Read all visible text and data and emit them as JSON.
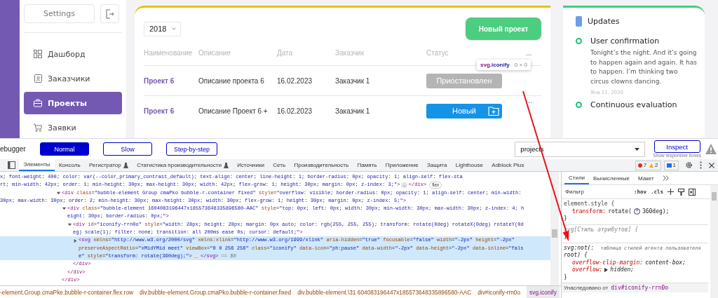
{
  "sidebar": {
    "settings": "Settings",
    "items": [
      {
        "label": "Дашборд",
        "selected": false
      },
      {
        "label": "Заказчики",
        "selected": false
      },
      {
        "label": "Проекты",
        "selected": true
      },
      {
        "label": "Заявки",
        "selected": false
      }
    ]
  },
  "projects": {
    "year": "2018",
    "new_button": "Новый проект",
    "columns": [
      "Наименование",
      "Описание",
      "Дата",
      "Заказчик",
      "Статус",
      "..."
    ],
    "rows": [
      {
        "name": "Проект 6",
        "description": "Описание проекта 6",
        "date": "16.02.2023",
        "customer": "Заказчик 1",
        "status": "Приостановлен",
        "kind": "paused",
        "tooltip": {
          "tag": "svg",
          "cls": ".iconify",
          "size": "0 × 0"
        }
      },
      {
        "name": "Проект 6",
        "description": "Описание Проект 6 +",
        "date": "16.02.2023",
        "customer": "Заказчик 1",
        "status": "Новый",
        "kind": "new",
        "menu": "..."
      }
    ]
  },
  "updates": {
    "title": "Updates",
    "items": [
      {
        "title": "User confirmation",
        "text": "Tonight’s the night. And it’s going to happen again and again. It has to happen. I’m thinking two circus clowns dancing.",
        "date": "Янв 21, 2020"
      },
      {
        "title": "Continuous evaluation"
      }
    ]
  },
  "debugger": {
    "label": "ebugger",
    "modes": [
      {
        "label": "Normal",
        "selected": true
      },
      {
        "label": "Slow",
        "selected": false
      },
      {
        "label": "Step-by-step",
        "selected": false
      }
    ],
    "page": "projects",
    "inspect": "Inspect",
    "inspect_hint": "Show responsive boxes"
  },
  "devtools": {
    "tabs": [
      {
        "label": "Элементы",
        "selected": true,
        "experimental": false
      },
      {
        "label": "Консоль",
        "selected": false,
        "experimental": false
      },
      {
        "label": "Регистратор",
        "selected": false,
        "experimental": true
      },
      {
        "label": "Статистика производительности",
        "selected": false,
        "experimental": true
      },
      {
        "label": "Источники",
        "selected": false,
        "experimental": false
      },
      {
        "label": "Сеть",
        "selected": false,
        "experimental": false
      },
      {
        "label": "Производительность",
        "selected": false,
        "experimental": false
      },
      {
        "label": "Память",
        "selected": false,
        "experimental": false
      },
      {
        "label": "Приложение",
        "selected": false,
        "experimental": false
      },
      {
        "label": "Защита",
        "selected": false,
        "experimental": false
      },
      {
        "label": "Lighthouse",
        "selected": false,
        "experimental": false
      },
      {
        "label": "Adblock Plus",
        "selected": false,
        "experimental": false
      }
    ],
    "errors": "7",
    "warnings": "2",
    "infos": "1",
    "tree": [
      {
        "kind": "continuation",
        "selected": false,
        "lines": [
          "x; font-weight: 400; color: var(--color_primary_contrast_default); text-align: center; line-height: 1; border-radius: 0px; opacity: 1; align-self: flex-sta",
          "rt; min-width: 42px; order: 1; min-height: 30px; max-height: 30px; width: 42px; flex-grow: 1; height: 30px; margin: 0px; z-index: 3;\">"
        ],
        "ellipsis": "…",
        "after": "</div>",
        "badge": "flex"
      },
      {
        "kind": "element",
        "expanded": true,
        "selected": false,
        "lines": [
          "<div class=\"bubble-element Group cmaPko bubble-r-container fixed\" style=\"overflow: visible; border-radius: 0px; opacity: 1; align-self: center; min-width:",
          "30px; max-width: 30px; order: 2; min-height: 30px; max-height: 30px; width: 30px; flex-grow: 1; height: 30px; margin: 0px; z-index: 5;\">"
        ],
        "close": "</div>",
        "children": [
          {
            "kind": "element",
            "expanded": true,
            "selected": false,
            "lines": [
              "<div class=\"bubble-element 1604083196447x185573648335896580-AAC\" style=\"top: 0px; left: 0px; width: 30px; min-width: 30px; max-width: 30px; z-index: 4; h",
              "eight: 30px; border-radius: 0px;\">"
            ],
            "close": "</div>",
            "children": [
              {
                "kind": "element",
                "expanded": true,
                "selected": false,
                "lines": [
                  "<div id=\"iconify-rrn0o\" style=\"width: 28px; height: 28px; margin: 0px auto; color: rgb(255, 255, 255); transform: rotate(0deg) rotateX(0deg) rotateY(0d",
                  "eg) scale(1); filter: none; transition: all 200ms ease 0s; cursor: default;\">"
                ],
                "close": "</div>",
                "children": [
                  {
                    "kind": "element",
                    "expanded": false,
                    "selected": true,
                    "lines": [
                      "<svg xmlns=\"http://www.w3.org/2000/svg\" xmlns:xlink=\"http://www.w3.org/1999/xlink\" aria-hidden=\"true\" focusable=\"false\" width=\"-2px\" height=\"-2px\"",
                      "preserveAspectRatio=\"xMidYMid meet\" viewBox=\"0 0 256 256\" class=\"iconify\" data-icon=\"ph:pause\" data-width=\"-2px\" data-height=\"-2px\" data-inline=\"fals",
                      "e\" style=\"transform: rotate(360deg);\">"
                    ],
                    "ellipsis": "…",
                    "after": "</svg>",
                    "marker": "== $0"
                  }
                ]
              }
            ]
          }
        ]
      }
    ],
    "styles": {
      "tabs": [
        {
          "label": "Стили",
          "selected": true
        },
        {
          "label": "Вычисленные",
          "selected": false
        },
        {
          "label": "Макет",
          "selected": false
        }
      ],
      "filter_placeholder": "Фильтр",
      "hov": ":hov",
      "cls": ".cls",
      "rules": [
        {
          "kind": "inline",
          "selector": "element.style {",
          "props": [
            {
              "kind": "angle",
              "name": "transform:",
              "value": "rotate(",
              "value_after": "360deg);"
            }
          ],
          "close": "}"
        },
        {
          "kind": "attributes",
          "selector": "svg[Стиль атрибутов] {",
          "close": "}"
        },
        {
          "kind": "user-agent",
          "selector": "svg:not(:",
          "source": "таблица стилей агента пользователя",
          "selector_cont": "root) {",
          "props": [
            {
              "kind": "plain",
              "name": "overflow-clip-margin:",
              "value": "content-box;"
            },
            {
              "kind": "shorthand",
              "name": "overflow:",
              "value": "hidden;"
            }
          ],
          "close": "}"
        }
      ],
      "inherited_label": "Унаследовано от",
      "inherited_element": "div#iconify-rrn0o"
    },
    "breadcrumbs": [
      {
        "label": "-element.Group.cmaPke.bubble-r-container.flex.row",
        "selected": false
      },
      {
        "label": "div.bubble-element.Group.cmaPko.bubble-r-container.fixed",
        "selected": false
      },
      {
        "label": "div.bubble-element.\\31 604083196447x185573648335896580-AAC",
        "selected": false
      },
      {
        "label": "div#iconify-rrn0o",
        "selected": false
      },
      {
        "label": "svg.iconify",
        "selected": true
      }
    ]
  }
}
